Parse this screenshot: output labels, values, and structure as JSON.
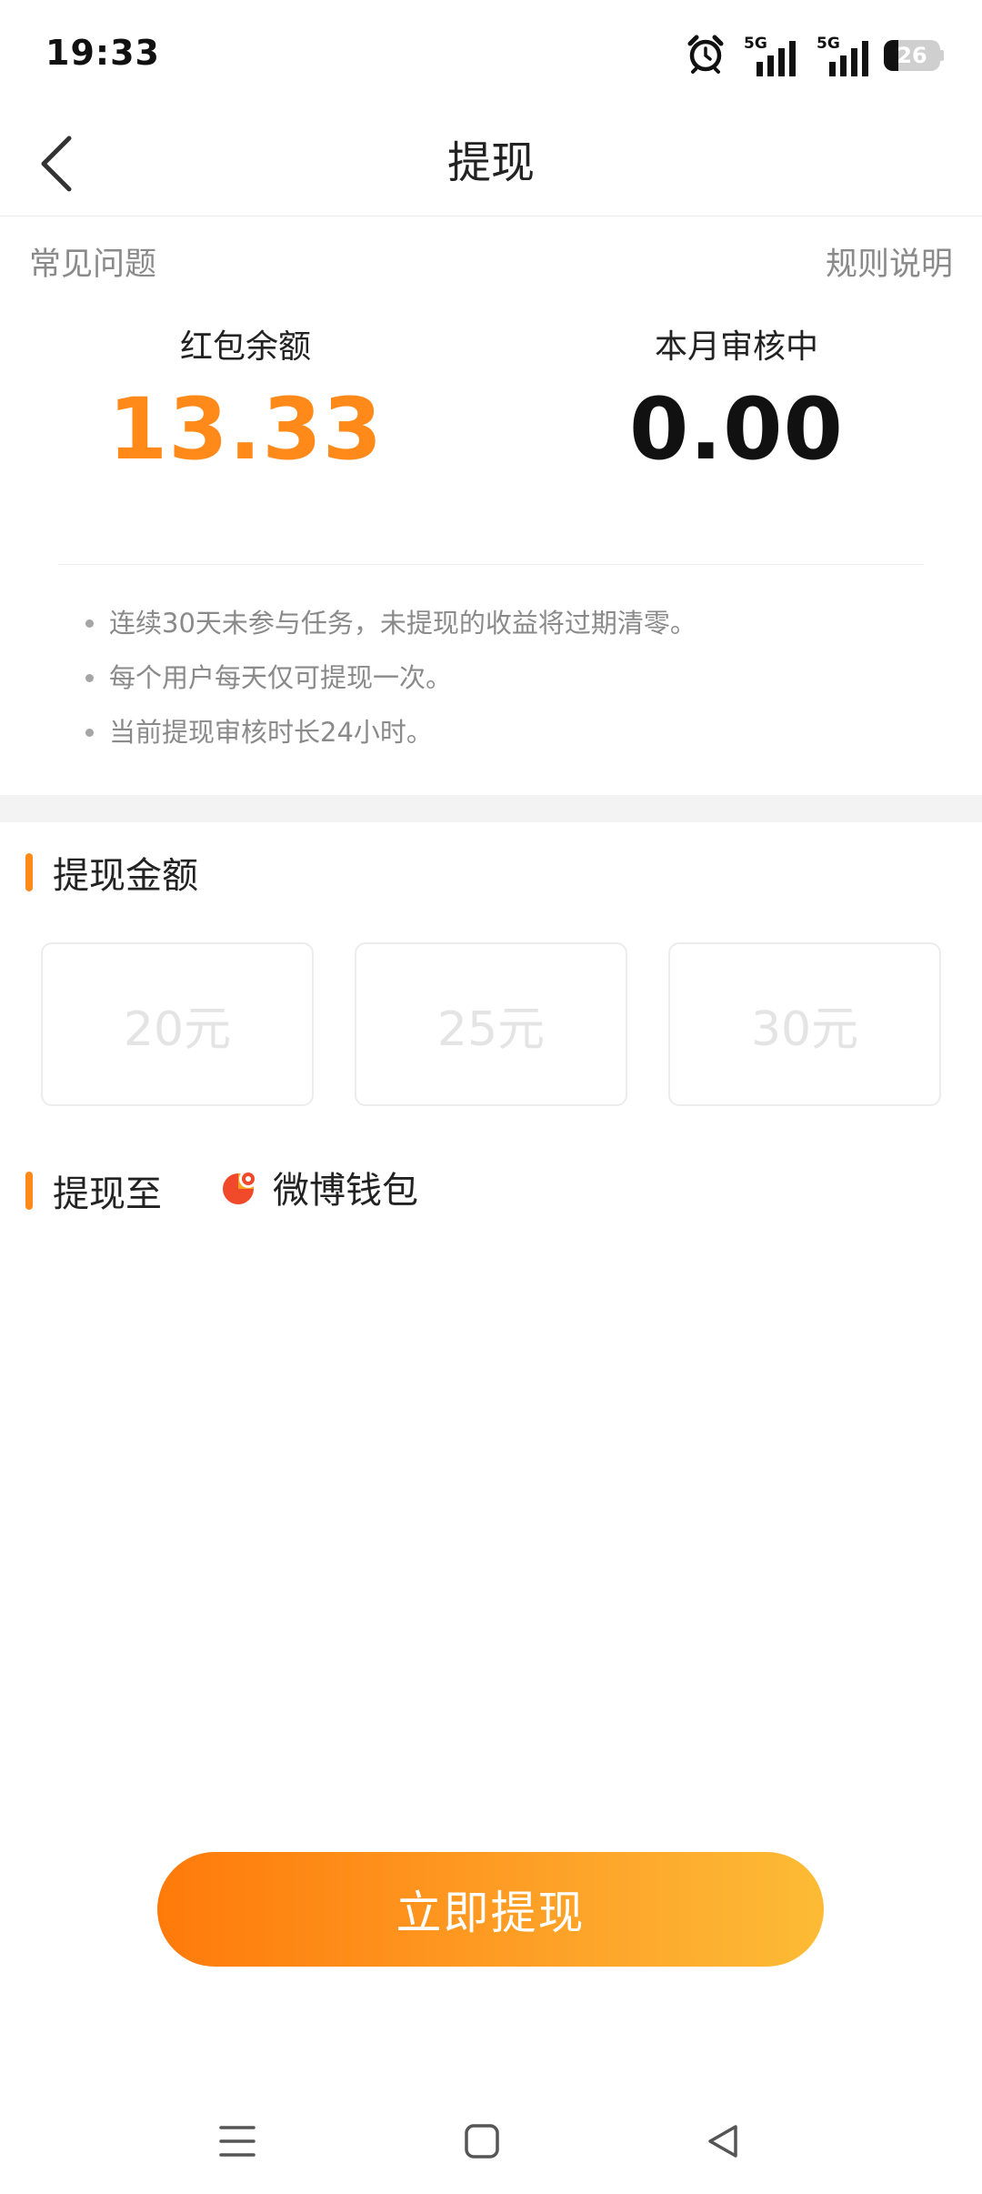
{
  "status_bar": {
    "time": "19:33",
    "network_1": "5G",
    "network_2": "5G",
    "battery_level": 26,
    "battery_text": "26"
  },
  "nav": {
    "title": "提现",
    "back_icon": "chevron-left-icon"
  },
  "links": {
    "faq": "常见问题",
    "rules": "规则说明"
  },
  "balances": {
    "red_packet_label": "红包余额",
    "red_packet_value": "13.33",
    "reviewing_label": "本月审核中",
    "reviewing_value": "0.00"
  },
  "tips": [
    "连续30天未参与任务，未提现的收益将过期清零。",
    "每个用户每天仅可提现一次。",
    "当前提现审核时长24小时。"
  ],
  "amount_section": {
    "title": "提现金额",
    "options": [
      "20元",
      "25元",
      "30元"
    ]
  },
  "target_section": {
    "title": "提现至",
    "wallet_name": "微博钱包"
  },
  "withdraw_button": "立即提现",
  "colors": {
    "accent": "#ff8a1a",
    "button_start": "#ff7a0a",
    "button_end": "#fdbb35",
    "muted_text": "#8a8a8a"
  }
}
